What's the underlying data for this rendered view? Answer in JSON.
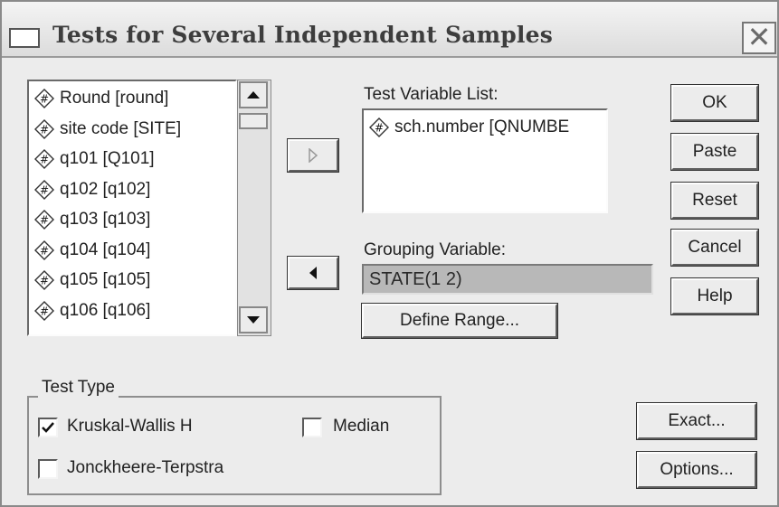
{
  "window": {
    "title": "Tests for Several Independent Samples"
  },
  "source_variables": [
    "Round [round]",
    "site code [SITE]",
    "q101 [Q101]",
    "q102 [q102]",
    "q103 [q103]",
    "q104 [q104]",
    "q105 [q105]",
    "q106 [q106]"
  ],
  "test_variable_list": {
    "label": "Test Variable List:",
    "items": [
      "sch.number [QNUMBE"
    ]
  },
  "grouping_variable": {
    "label": "Grouping Variable:",
    "value": "STATE(1 2)"
  },
  "buttons": {
    "ok": "OK",
    "paste": "Paste",
    "reset": "Reset",
    "cancel": "Cancel",
    "help": "Help",
    "define_range": "Define Range...",
    "exact": "Exact...",
    "options": "Options..."
  },
  "test_type": {
    "label": "Test Type",
    "kruskal_wallis": {
      "label": "Kruskal-Wallis H",
      "checked": true
    },
    "median": {
      "label": "Median",
      "checked": false
    },
    "jonckheere": {
      "label": "Jonckheere-Terpstra",
      "checked": false
    }
  },
  "icons": {
    "variable": "numeric-variable-icon",
    "move_right": "right-arrow-icon",
    "move_left": "left-arrow-icon",
    "close": "close-icon"
  }
}
